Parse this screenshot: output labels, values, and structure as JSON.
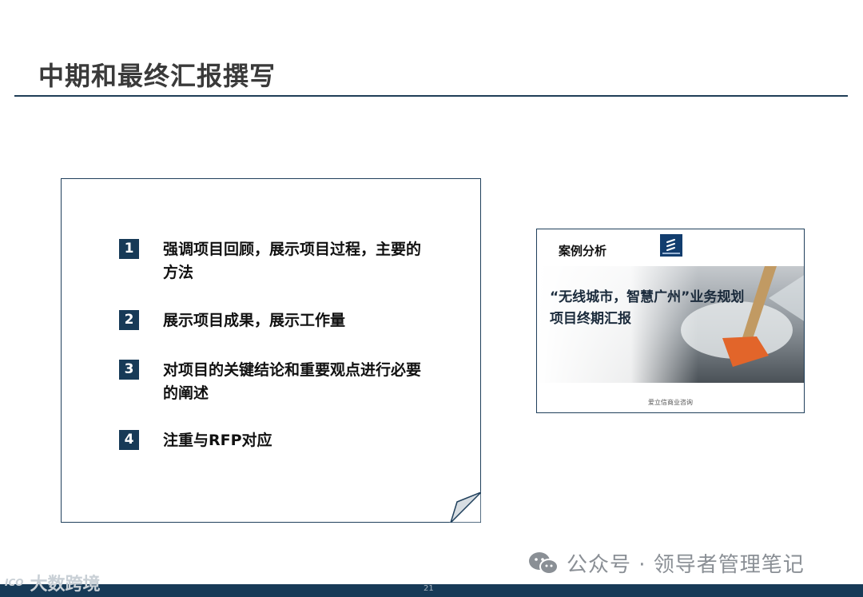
{
  "slide": {
    "title": "中期和最终汇报撰写",
    "page_number": "21"
  },
  "points": [
    {
      "num": "1",
      "text": "强调项目回顾，展示项目过程，主要的方法"
    },
    {
      "num": "2",
      "text": "展示项目成果，展示工作量"
    },
    {
      "num": "3",
      "text": "对项目的关键结论和重要观点进行必要的阐述"
    },
    {
      "num": "4",
      "text": "注重与RFP对应"
    }
  ],
  "case_study": {
    "label": "案例分析",
    "headline_line1": "“无线城市，智慧广州”业务规划",
    "headline_line2": "项目终期汇报",
    "footer": "爱立信商业咨询"
  },
  "watermark": {
    "text": "公众号 · 领导者管理笔记"
  },
  "brand": {
    "mark": "ICO",
    "name": "大数跨境"
  },
  "colors": {
    "navy": "#173a57",
    "rule": "#1f3d57"
  }
}
